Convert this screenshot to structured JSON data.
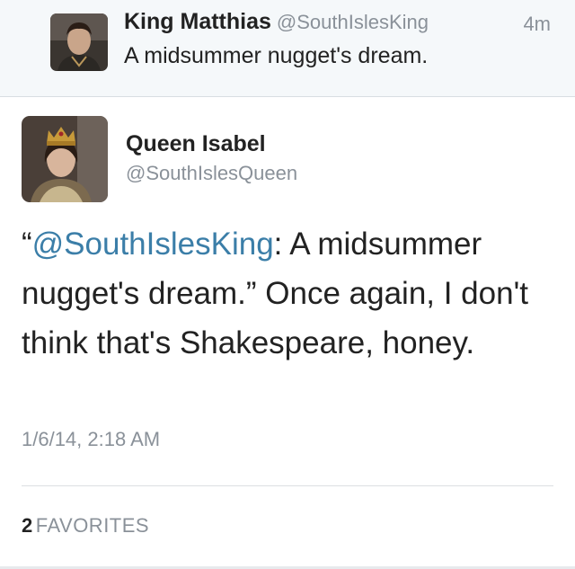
{
  "parent_tweet": {
    "name": "King Matthias",
    "handle": "@SouthIslesKing",
    "time": "4m",
    "text": "A midsummer nugget's dream."
  },
  "main_tweet": {
    "name": "Queen Isabel",
    "handle": "@SouthIslesQueen",
    "quote_open": "“",
    "mention": "@SouthIslesKing",
    "text_rest": ": A midsummer nugget's dream.” Once again, I don't think that's Shakespeare, honey.",
    "timestamp": "1/6/14, 2:18 AM",
    "favorites_count": "2",
    "favorites_label": "FAVORITES"
  },
  "colors": {
    "mention": "#3b7ea8",
    "muted": "#8a9199",
    "text": "#222222"
  }
}
